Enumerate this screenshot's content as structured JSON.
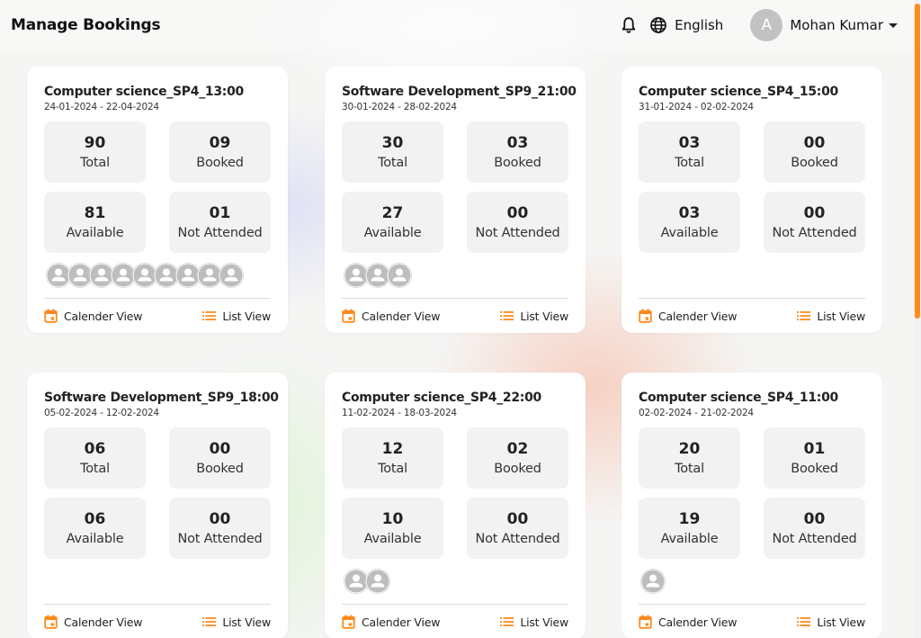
{
  "header": {
    "title": "Manage Bookings",
    "notification_icon": "bell-icon",
    "language_icon": "globe-icon",
    "language": "English",
    "user": {
      "avatar_initial": "A",
      "name": "Mohan Kumar"
    }
  },
  "colors": {
    "accent": "#ff8a1d",
    "stat_bg": "#f2f2f2",
    "avatar_gray": "#bdbdbd"
  },
  "labels": {
    "total": "Total",
    "booked": "Booked",
    "available": "Available",
    "not_attended": "Not Attended",
    "calendar_view": "Calender View",
    "list_view": "List View"
  },
  "cards": [
    {
      "title": "Computer science_SP4_13:00",
      "dates": "24-01-2024 - 22-04-2024",
      "total": "90",
      "booked": "09",
      "available": "81",
      "not_attended": "01",
      "attendee_count": 9
    },
    {
      "title": "Software Development_SP9_21:00",
      "dates": "30-01-2024 - 28-02-2024",
      "total": "30",
      "booked": "03",
      "available": "27",
      "not_attended": "00",
      "attendee_count": 3
    },
    {
      "title": "Computer science_SP4_15:00",
      "dates": "31-01-2024 - 02-02-2024",
      "total": "03",
      "booked": "00",
      "available": "03",
      "not_attended": "00",
      "attendee_count": 0
    },
    {
      "title": "Software Development_SP9_18:00",
      "dates": "05-02-2024 - 12-02-2024",
      "total": "06",
      "booked": "00",
      "available": "06",
      "not_attended": "00",
      "attendee_count": 0
    },
    {
      "title": "Computer science_SP4_22:00",
      "dates": "11-02-2024 - 18-03-2024",
      "total": "12",
      "booked": "02",
      "available": "10",
      "not_attended": "00",
      "attendee_count": 2
    },
    {
      "title": "Computer science_SP4_11:00",
      "dates": "02-02-2024 - 21-02-2024",
      "total": "20",
      "booked": "01",
      "available": "19",
      "not_attended": "00",
      "attendee_count": 1
    }
  ]
}
